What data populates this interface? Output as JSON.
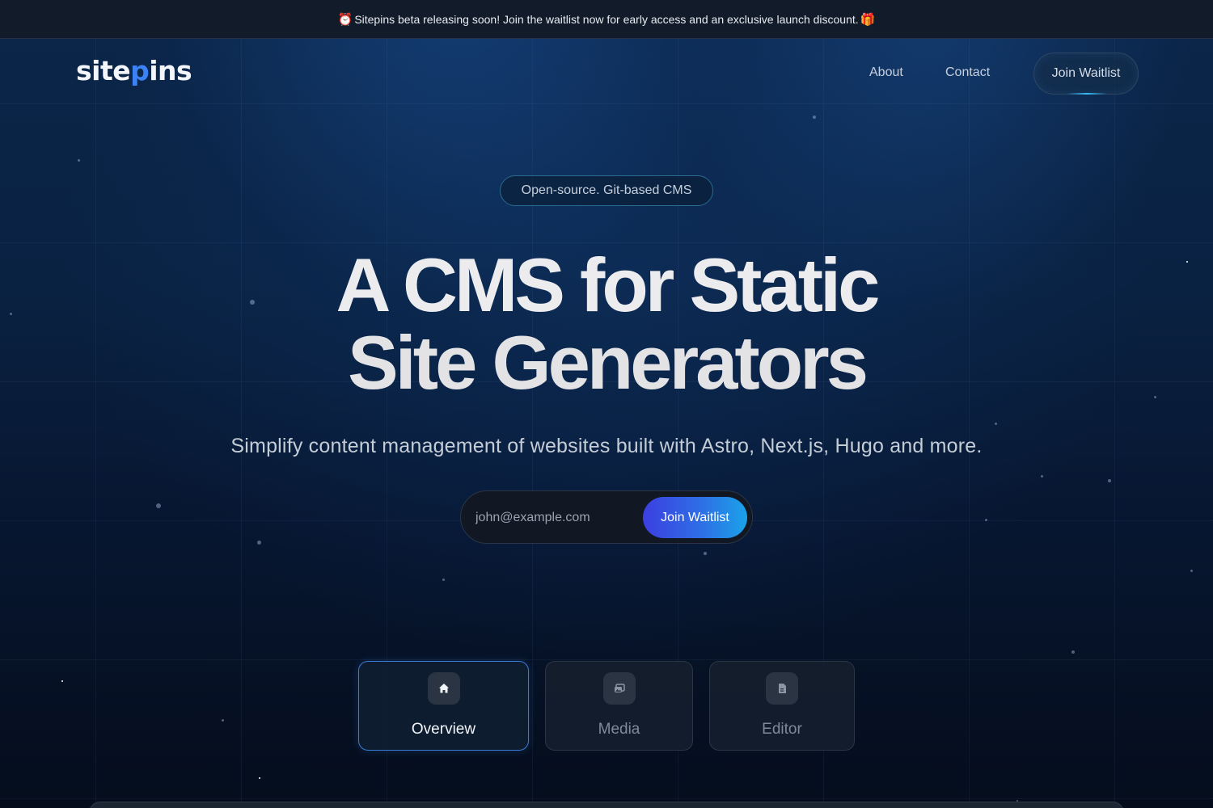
{
  "announcement": {
    "icon_left": "alarm-clock-icon",
    "text": "Sitepins beta releasing soon! Join the waitlist now for early access and an exclusive launch discount.",
    "icon_right": "gift-icon"
  },
  "nav": {
    "logo": {
      "text_a": "site",
      "text_b": "p",
      "text_c": "ins",
      "accent": "#3b82f6"
    },
    "links": [
      "About",
      "Contact"
    ],
    "cta": "Join Waitlist"
  },
  "hero": {
    "badge": "Open-source. Git-based CMS",
    "title_line1": "A CMS for Static",
    "title_line2": "Site Generators",
    "subtitle": "Simplify content management of websites built with Astro, Next.js, Hugo and more."
  },
  "signup": {
    "placeholder": "john@example.com",
    "button": "Join Waitlist"
  },
  "tabs": [
    {
      "label": "Overview",
      "icon": "home-icon",
      "active": true
    },
    {
      "label": "Media",
      "icon": "images-icon",
      "active": false
    },
    {
      "label": "Editor",
      "icon": "document-icon",
      "active": false
    }
  ],
  "colors": {
    "background": "#0a2242",
    "button_gradient_start": "#3b3fe0",
    "button_gradient_end": "#1aa2e8",
    "active_tab_border": "#3a7bd5"
  }
}
